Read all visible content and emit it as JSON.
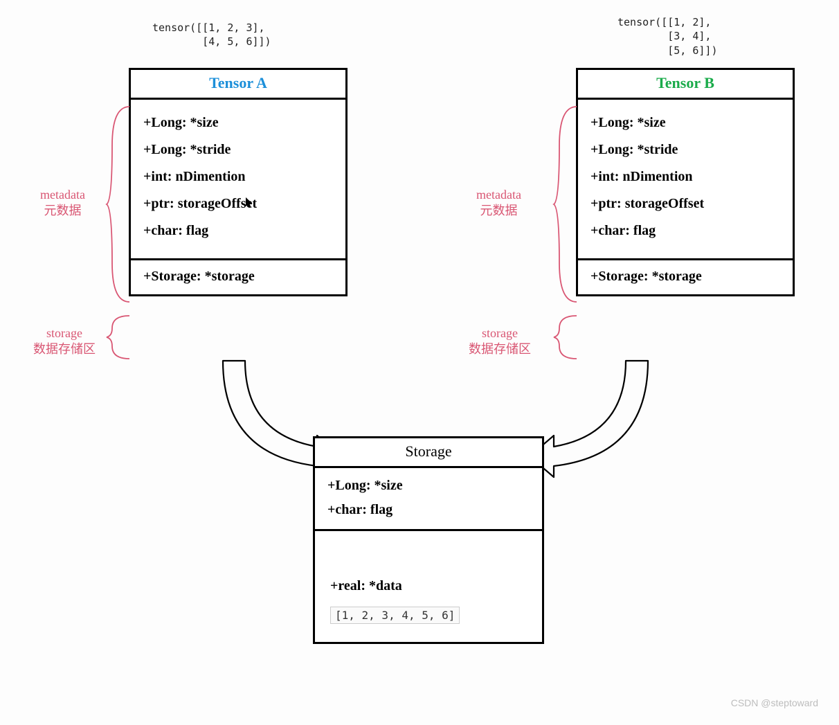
{
  "code_a": "tensor([[1, 2, 3],\n        [4, 5, 6]])",
  "code_b": "tensor([[1, 2],\n        [3, 4],\n        [5, 6]])",
  "tensor_a": {
    "title": "Tensor A",
    "attrs": [
      "+Long: *size",
      "+Long: *stride",
      "+int: nDimention",
      "+ptr: storageOffset",
      "+char: flag"
    ],
    "storage_attr": "+Storage: *storage",
    "shape": [
      2,
      3
    ]
  },
  "tensor_b": {
    "title": "Tensor B",
    "attrs": [
      "+Long: *size",
      "+Long: *stride",
      "+int: nDimention",
      "+ptr: storageOffset",
      "+char: flag"
    ],
    "storage_attr": "+Storage: *storage",
    "shape": [
      3,
      2
    ]
  },
  "labels": {
    "metadata_en": "metadata",
    "metadata_zh": "元数据",
    "storage_en": "storage",
    "storage_zh": "数据存储区"
  },
  "storage": {
    "title": "Storage",
    "attrs": [
      "+Long: *size",
      "+char: flag"
    ],
    "data_attr": "+real: *data",
    "data": [
      1,
      2,
      3,
      4,
      5,
      6
    ]
  },
  "watermark": "CSDN @steptoward"
}
